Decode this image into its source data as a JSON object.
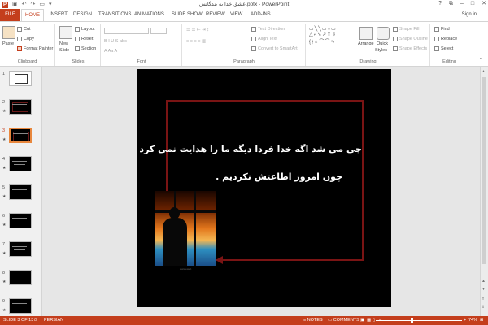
{
  "app": {
    "title": "عشق خدا به بندگانش.pptx - PowerPoint",
    "app_icon_letter": "P",
    "accent": "#c43e1c",
    "quick_access": {
      "save_icon": "save-icon",
      "undo_icon": "undo-icon",
      "redo_icon": "redo-icon"
    },
    "window_controls": {
      "help": "?",
      "restore": "⧉",
      "minimize": "–",
      "maximize": "□",
      "close": "✕"
    }
  },
  "tabs": [
    "FILE",
    "HOME",
    "INSERT",
    "DESIGN",
    "TRANSITIONS",
    "ANIMATIONS",
    "SLIDE SHOW",
    "REVIEW",
    "VIEW",
    "ADD-INS"
  ],
  "signin": "Sign in",
  "ribbon": {
    "clipboard": {
      "paste": "Paste",
      "cut": "Cut",
      "copy": "Copy",
      "format_painter": "Format Painter",
      "label": "Clipboard"
    },
    "slides": {
      "new_slide": "New",
      "new_slide_2": "Slide",
      "layout": "Layout",
      "reset": "Reset",
      "section": "Section",
      "label": "Slides"
    },
    "font": {
      "label": "Font"
    },
    "paragraph": {
      "text_direction": "Text Direction",
      "align_text": "Align Text",
      "convert_smartart": "Convert to SmartArt",
      "label": "Paragraph"
    },
    "drawing": {
      "arrange": "Arrange",
      "quick_styles": "Quick",
      "quick_styles_2": "Styles",
      "shape_fill": "Shape Fill",
      "shape_outline": "Shape Outline",
      "shape_effects": "Shape Effects",
      "label": "Drawing"
    },
    "editing": {
      "find": "Find",
      "replace": "Replace",
      "select": "Select",
      "label": "Editing"
    }
  },
  "thumbnails": [
    {
      "num": "1",
      "star": ""
    },
    {
      "num": "2",
      "star": "★"
    },
    {
      "num": "3",
      "star": "★"
    },
    {
      "num": "4",
      "star": "★"
    },
    {
      "num": "5",
      "star": "★"
    },
    {
      "num": "6",
      "star": "★"
    },
    {
      "num": "7",
      "star": "★"
    },
    {
      "num": "8",
      "star": "★"
    },
    {
      "num": "9",
      "star": "★"
    }
  ],
  "slide": {
    "line1": "چي مي شد اگه خدا فردا ديگه ما را هدايت نمي كرد",
    "line2": "چون امروز اطاعتش نكرديم .",
    "photo_caption": "www.eweb"
  },
  "status": {
    "slide_of": "SLIDE 3 OF 13",
    "language": "PERSIAN",
    "notes": "NOTES",
    "comments": "COMMENTS",
    "zoom": "74%",
    "zoom_fraction": 0.74
  }
}
